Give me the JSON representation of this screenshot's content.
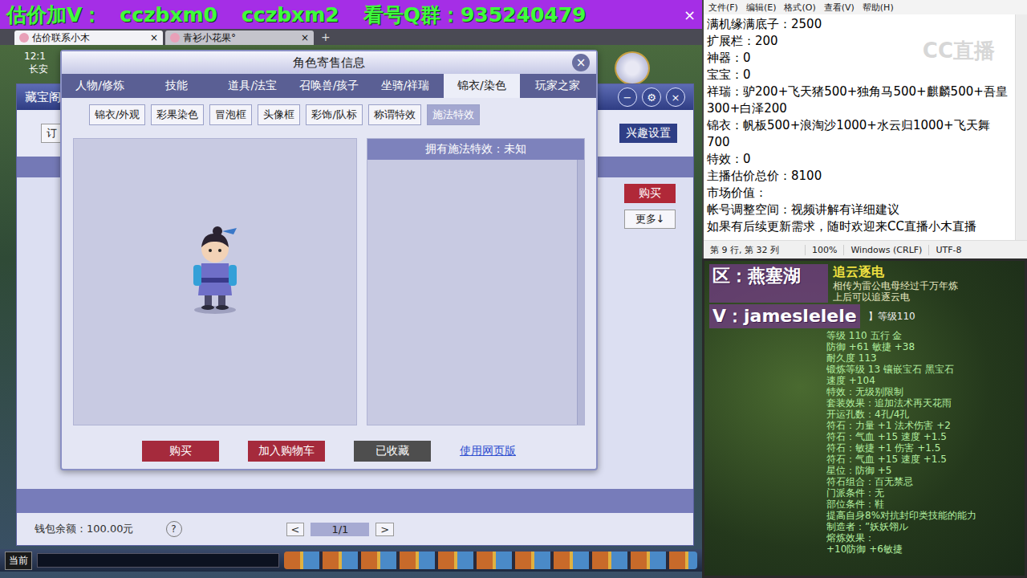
{
  "banner": {
    "items": [
      "估价加V：",
      "cczbxm0",
      "cczbxm2",
      "看号Q群：935240479"
    ],
    "close": "×"
  },
  "browser_tabs": [
    {
      "label": "估价联系小木",
      "close": "×",
      "selected": true
    },
    {
      "label": "青衫小花果°",
      "close": "×",
      "selected": false
    }
  ],
  "new_tab": "+",
  "game_hud": {
    "time": "12:1",
    "location": "长安",
    "chat_channel": "当前"
  },
  "market_window": {
    "title": "藏宝阁",
    "controls": [
      "−",
      "⚙",
      "×"
    ],
    "order_button": "订",
    "interest_button": "兴趣设置",
    "buy_button": "购买",
    "more_button": "更多↓",
    "wallet": "钱包余额：100.00元",
    "help": "?",
    "pager": {
      "prev": "<",
      "page": "1/1",
      "next": ">"
    }
  },
  "dialog": {
    "title": "角色寄售信息",
    "close": "×",
    "tabs": [
      {
        "label": "人物/修炼",
        "selected": false
      },
      {
        "label": "技能",
        "selected": false
      },
      {
        "label": "道具/法宝",
        "selected": false
      },
      {
        "label": "召唤兽/孩子",
        "selected": false
      },
      {
        "label": "坐骑/祥瑞",
        "selected": false
      },
      {
        "label": "锦衣/染色",
        "selected": true
      },
      {
        "label": "玩家之家",
        "selected": false
      }
    ],
    "subtabs": [
      {
        "label": "锦衣/外观",
        "selected": false
      },
      {
        "label": "彩果染色",
        "selected": false
      },
      {
        "label": "冒泡框",
        "selected": false
      },
      {
        "label": "头像框",
        "selected": false
      },
      {
        "label": "彩饰/队标",
        "selected": false
      },
      {
        "label": "称谓特效",
        "selected": false
      },
      {
        "label": "施法特效",
        "selected": true
      }
    ],
    "effects_header": "拥有施法特效：未知",
    "buttons": [
      {
        "label": "购买",
        "kind": "primary"
      },
      {
        "label": "加入购物车",
        "kind": "primary"
      },
      {
        "label": "已收藏",
        "kind": "muted"
      },
      {
        "label": "使用网页版",
        "kind": "link"
      }
    ]
  },
  "notepad": {
    "menu": [
      "文件(F)",
      "编辑(E)",
      "格式(O)",
      "查看(V)",
      "帮助(H)"
    ],
    "watermark": "CC直播",
    "lines": [
      "满机缘满底子：2500",
      "扩展栏：200",
      "神器：0",
      "宝宝：0",
      "祥瑞：驴200+飞天猪500+独角马500+麒麟500+吾皇300+白泽200",
      "锦衣：帆板500+浪淘沙1000+水云归1000+飞天舞700",
      "特效：0",
      "主播估价总价：8100",
      "市场价值：",
      "帐号调整空间：视频讲解有详细建议",
      "如果有后续更新需求，随时欢迎来CC直播小木直播"
    ],
    "status": [
      "第 9 行, 第 32 列",
      "100%",
      "Windows (CRLF)",
      "UTF-8"
    ]
  },
  "stream_capture": {
    "region_label": "区：燕塞湖",
    "contact_label": "V：jameslelele",
    "item": {
      "name": "追云逐电",
      "description": [
        "相传为雷公电母经过千万年炼",
        "上后可以追逐云电"
      ],
      "requirement": "】等级110",
      "stats": [
        "等级 110  五行 金",
        "防御 +61 敏捷 +38",
        "耐久度 113",
        "锻炼等级 13  镶嵌宝石 黑宝石",
        "速度 +104",
        "特效：无级别限制",
        "套装效果：追加法术再天花雨",
        "开运孔数：4孔/4孔",
        "符石：力量 +1 法术伤害 +2",
        "符石：气血 +15 速度 +1.5",
        "符石：敏捷 +1 伤害 +1.5",
        "符石：气血 +15 速度 +1.5",
        "星位：防御 +5",
        "符石组合：百无禁忌",
        "门派条件：无",
        "部位条件：鞋",
        "提高自身8%对抗封印类技能的能力",
        "制造者：”妖妖翎ル",
        "熔炼效果：",
        "+10防御 +6敏捷"
      ]
    }
  }
}
